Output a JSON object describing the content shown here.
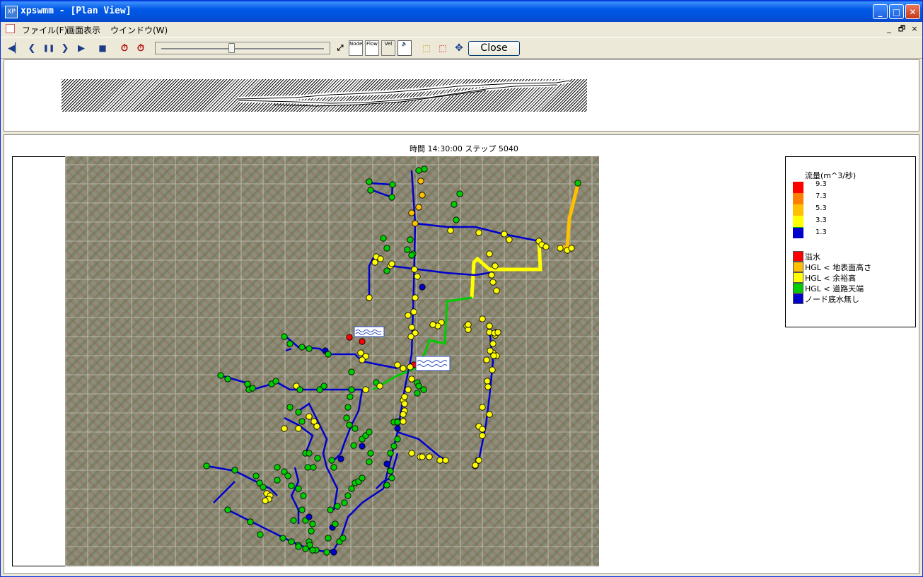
{
  "window": {
    "title": "xpswmm - [Plan View]",
    "icon_text": "XP",
    "controls": {
      "minimize": "_",
      "maximize": "□",
      "close": "✕"
    }
  },
  "menubar": {
    "items": [
      {
        "label": "ファイル(F)"
      },
      {
        "label": "画面表示"
      },
      {
        "label": "ウインドウ(W)"
      }
    ],
    "mdi_controls": {
      "minimize": "_",
      "restore": "🗗",
      "close": "×"
    }
  },
  "toolbar": {
    "playback": [
      {
        "icon": "rewind-start-icon",
        "glyph": "◀▏"
      },
      {
        "icon": "step-back-icon",
        "glyph": "❮"
      },
      {
        "icon": "pause-icon",
        "glyph": "❚❚"
      },
      {
        "icon": "step-forward-icon",
        "glyph": "❯"
      },
      {
        "icon": "play-icon",
        "glyph": "▶"
      },
      {
        "icon": "stop-icon",
        "glyph": "■"
      },
      {
        "icon": "timer-icon",
        "glyph": "⏱"
      },
      {
        "icon": "timer-reset-icon",
        "glyph": "⏱"
      }
    ],
    "slider_position": 0.43,
    "toggles": [
      {
        "icon": "node-toggle-icon",
        "label": "Node"
      },
      {
        "icon": "flow-toggle-icon",
        "label": "Flow"
      },
      {
        "icon": "vel-toggle-icon",
        "label": "Vel"
      }
    ],
    "close_label": "Close"
  },
  "plan": {
    "time_label": "時間 14:30:00 ステップ 5040"
  },
  "legend": {
    "title": "流量(m^3/秒)",
    "flow_classes": [
      {
        "value": "9.3",
        "color": "#ff0000"
      },
      {
        "value": "7.3",
        "color": "#ff8000"
      },
      {
        "value": "5.3",
        "color": "#ffc000"
      },
      {
        "value": "3.3",
        "color": "#ffff00"
      },
      {
        "value": "1.3",
        "color": "#00cc00"
      },
      {
        "value": "",
        "color": "#0000cc"
      }
    ],
    "node_status": [
      {
        "label": "溢水",
        "color": "#ff0000"
      },
      {
        "label": "HGL < 地表面高さ",
        "color": "#ffc000"
      },
      {
        "label": "HGL < 余裕高",
        "color": "#ffff00"
      },
      {
        "label": "HGL < 道路天端",
        "color": "#00cc00"
      },
      {
        "label": "ノード底水無し",
        "color": "#0000cc"
      }
    ]
  }
}
